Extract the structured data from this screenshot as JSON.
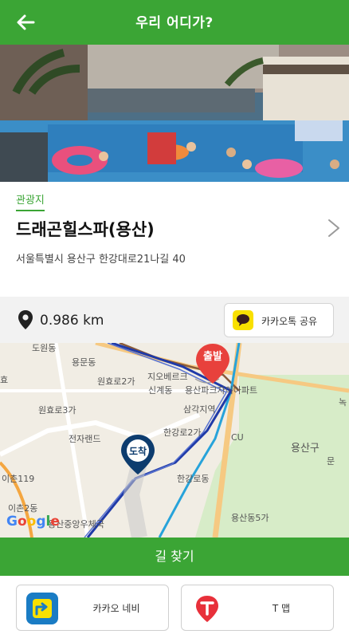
{
  "header": {
    "title": "우리 어디가?"
  },
  "place": {
    "category": "관광지",
    "name": "드래곤힐스파(용산)",
    "address": "서울특별시 용산구 한강대로21나길 40"
  },
  "distance": {
    "value": "0.986 km"
  },
  "share": {
    "kakao_label": "카카오톡 공유"
  },
  "map": {
    "labels": [
      "도원동",
      "용문동",
      "원효로2가",
      "원효로3가",
      "지오베르크",
      "신계동",
      "용산파크자이아파트",
      "삼각지역",
      "한강로2가",
      "전자랜드",
      "CU",
      "용산구",
      "이촌119",
      "한강로동",
      "이촌2동",
      "용산중앙우체국",
      "용산동5가",
      "녹",
      "효",
      "문"
    ],
    "start_marker": "출발",
    "end_marker": "도착",
    "logo": "Google"
  },
  "actions": {
    "find_route": "길 찾기"
  },
  "nav_apps": {
    "kakao_navi": "카카오 네비",
    "tmap": "T 맵"
  },
  "colors": {
    "brand_green": "#3ba535",
    "start_red": "#e8413c",
    "end_navy": "#0d3c6e",
    "kakao_yellow": "#f9e000"
  }
}
